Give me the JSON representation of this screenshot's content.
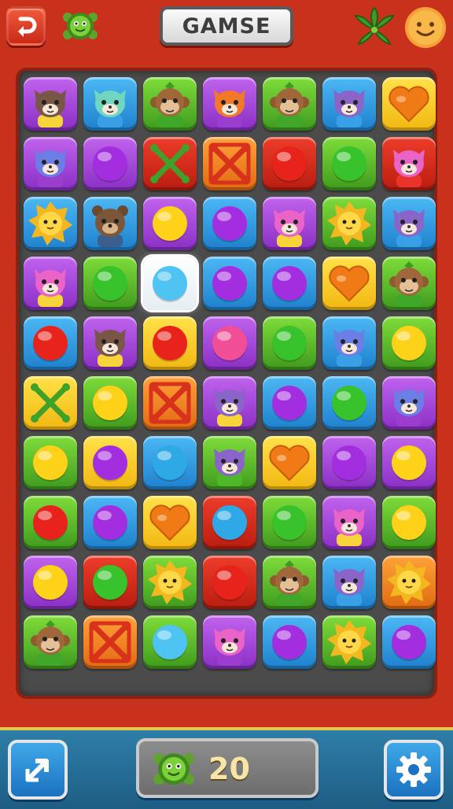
{
  "header": {
    "title": "GAMSE",
    "back_icon": "undo-arrow-icon",
    "turtle_icon": "turtle-icon",
    "leaf_icon": "leaf-icon",
    "smiley_icon": "smiley-face-icon"
  },
  "footer": {
    "score": "20",
    "share_icon": "share-arrow-icon",
    "score_icon": "turtle-icon",
    "settings_icon": "gear-icon"
  },
  "colors": {
    "background": "#c8321d",
    "board": "#4b4b4b",
    "bottom_bar": "#1e5d84"
  },
  "board": {
    "columns": 7,
    "rows": 10,
    "selected": {
      "row": 3,
      "col": 2
    },
    "grid": [
      [
        "cat-brown-yellow",
        "cat-teal-blue",
        "monkey-green",
        "cat-orange-purple",
        "monkey-green",
        "cat-purple-blue",
        "heart-orange-yellow"
      ],
      [
        "cat-blue-purple",
        "gem-purple",
        "cross-green-red",
        "cross-red-orange",
        "gem-red",
        "gem-green",
        "cat-pink-red"
      ],
      [
        "lion-yellow-blue",
        "bear-brown-blue",
        "gem-yellow-purple",
        "gem-purple-blue",
        "cat-pink-yellow",
        "lion-yellow-green",
        "cat-purple-blue"
      ],
      [
        "cat-pink-yellow",
        "gem-green",
        "gem-cyan-white",
        "gem-purple-blue",
        "gem-purple-blue",
        "heart-orange-yellow",
        "monkey-green"
      ],
      [
        "gem-red-blue",
        "cat-brown-yellow",
        "gem-red-yellow",
        "gem-pink-purple",
        "gem-green",
        "cat-blue-blue",
        "gem-yellow-green"
      ],
      [
        "cross-green-yellow",
        "gem-yellow-green",
        "cross-red-orange",
        "cat-purple-yellow",
        "gem-purple-blue",
        "gem-green-blue",
        "cat-blue-purple"
      ],
      [
        "gem-yellow-green",
        "gem-purple-yellow",
        "gem-blue-blue",
        "cat-purple-green",
        "heart-orange-yellow",
        "gem-purple-purple",
        "gem-yellow-purple"
      ],
      [
        "gem-red-green",
        "gem-purple-blue",
        "heart-orange-yellow",
        "gem-blue-red",
        "gem-green",
        "cat-pink-yellow",
        "gem-yellow-green"
      ],
      [
        "gem-yellow-purple",
        "gem-green-red",
        "lion-yellow-green",
        "gem-red",
        "monkey-green",
        "cat-purple-blue",
        "lion-yellow-orange"
      ],
      [
        "monkey-green",
        "cross-red-orange",
        "gem-cyan-green",
        "cat-pink-purple",
        "gem-purple-blue",
        "lion-yellow-green",
        "gem-purple-blue"
      ]
    ]
  }
}
